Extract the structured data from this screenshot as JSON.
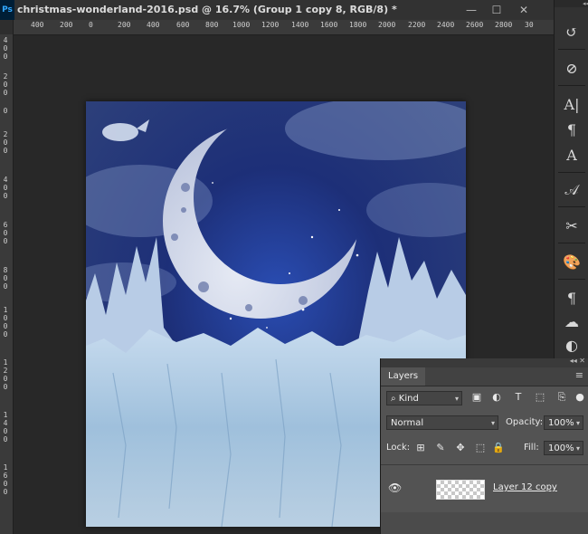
{
  "titlebar": {
    "app_badge": "Ps",
    "document_title": "christmas-wonderland-2016.psd @ 16.7% (Group 1 copy 8, RGB/8) *",
    "minimize": "—",
    "maximize": "☐",
    "close": "✕"
  },
  "ruler_h": {
    "ticks": [
      "400",
      "200",
      "0",
      "200",
      "400",
      "600",
      "800",
      "1000",
      "1200",
      "1400",
      "1600",
      "1800",
      "2000",
      "2200",
      "2400",
      "2600",
      "2800",
      "30"
    ]
  },
  "ruler_v": {
    "ticks": [
      "4 0 0",
      "2 0 0",
      "0",
      "2 0 0",
      "4 0 0",
      "6 0 0",
      "8 0 0",
      "1 0 0 0",
      "1 2 0 0",
      "1 4 0 0",
      "1 6 0 0"
    ]
  },
  "right_toolbar": {
    "collapse": "◂◂",
    "tools": [
      {
        "icon": "history-brush-icon",
        "glyph": "↺"
      },
      {
        "icon": "adjustments-icon",
        "glyph": "⊘"
      },
      {
        "icon": "character-icon",
        "glyph": "A|"
      },
      {
        "icon": "paragraph-icon",
        "glyph": "¶"
      },
      {
        "icon": "character-style-icon",
        "glyph": "A"
      },
      {
        "icon": "glyph-icon",
        "glyph": "𝒜"
      },
      {
        "icon": "tools-icon",
        "glyph": "✂"
      },
      {
        "icon": "swatches-icon",
        "glyph": "🎨"
      },
      {
        "icon": "paragraph-style-icon",
        "glyph": "¶"
      },
      {
        "icon": "libraries-icon",
        "glyph": "☁"
      },
      {
        "icon": "color-icon",
        "glyph": "◐"
      }
    ]
  },
  "layers_panel": {
    "collapse": "◂◂ ✕",
    "tab_label": "Layers",
    "menu_icon": "≡",
    "filter": {
      "icon": "search-icon",
      "label": "Kind"
    },
    "blend_mode": "Normal",
    "opacity_label": "Opacity:",
    "opacity_value": "100%",
    "lock_label": "Lock:",
    "fill_label": "Fill:",
    "fill_value": "100%",
    "layers": [
      {
        "name": "Layer 12 copy",
        "visible": true
      }
    ]
  }
}
